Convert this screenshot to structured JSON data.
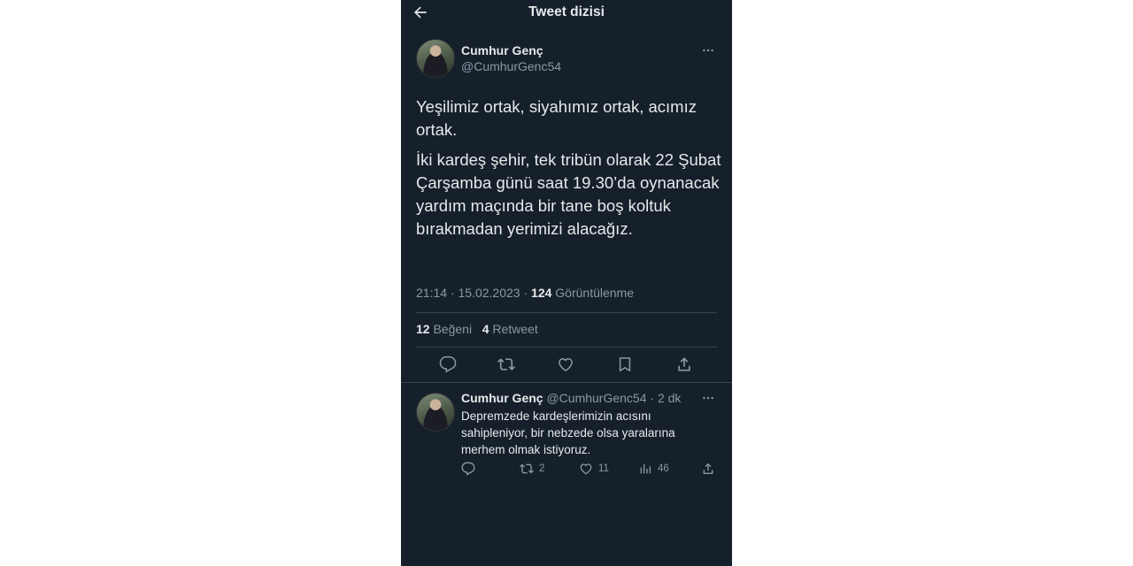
{
  "header": {
    "title": "Tweet dizisi"
  },
  "main_tweet": {
    "name": "Cumhur Genç",
    "handle": "@CumhurGenc54",
    "paragraph1": "Yeşilimiz ortak, siyahımız ortak, acımız ortak.",
    "paragraph2": "İki kardeş şehir, tek tribün olarak 22 Şubat Çarşamba günü saat 19.30’da oynanacak yardım maçında bir tane boş koltuk bırakmadan yerimizi alacağız.",
    "time": "21:14",
    "date": "15.02.2023",
    "views_count": "124",
    "views_label": "Görüntülenme",
    "likes_count": "12",
    "likes_label": "Beğeni",
    "retweets_count": "4",
    "retweets_label": "Retweet"
  },
  "reply_tweet": {
    "name": "Cumhur Genç",
    "handle": "@CumhurGenc54",
    "age": "2 dk",
    "text": "Depremzede kardeşlerimizin acısını sahipleniyor, bir nebzede olsa yaralarına merhem olmak istiyoruz.",
    "retweets": "2",
    "likes": "11",
    "views": "46"
  },
  "icons": {
    "back": "arrow-left-icon",
    "more": "more-dots-icon",
    "reply": "comment-icon",
    "retweet": "retweet-icon",
    "like": "heart-icon",
    "bookmark": "bookmark-icon",
    "share": "share-icon",
    "analytics": "analytics-icon"
  },
  "colors": {
    "background": "#15202b",
    "text": "#e7e9ea",
    "secondary_text": "#8b98a5",
    "divider": "#38444d"
  }
}
